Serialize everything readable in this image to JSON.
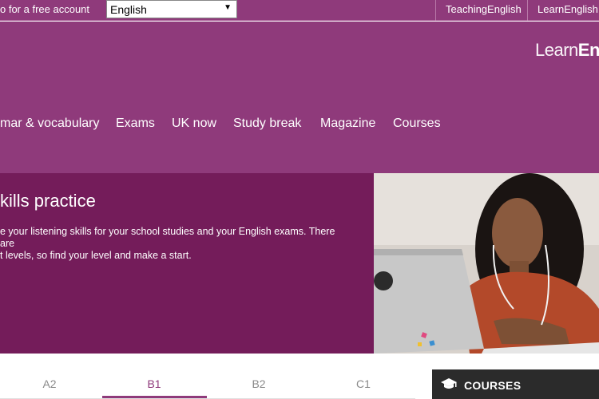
{
  "topbar": {
    "signup_text": "o for a free account",
    "language_select": {
      "value": "English"
    },
    "links": [
      "TeachingEnglish",
      "LearnEnglish K"
    ]
  },
  "header": {
    "logo": {
      "part1": "Learn",
      "part2": "En"
    },
    "nav": [
      "mar & vocabulary",
      "Exams",
      "UK now",
      "Study break",
      "Magazine",
      "Courses"
    ]
  },
  "hero": {
    "title": "kills practice",
    "text_line1": "e your listening skills for your school studies and your English exams. There are",
    "text_line2": "t levels, so find your level and make a start."
  },
  "tabs": {
    "items": [
      "A2",
      "B1",
      "B2",
      "C1"
    ],
    "active": "B1"
  },
  "courses_box": {
    "label": "COURSES"
  },
  "colors": {
    "brand_purple": "#8f3a7b",
    "hero_purple": "#741c5a",
    "dark_panel": "#2b2b2b"
  }
}
